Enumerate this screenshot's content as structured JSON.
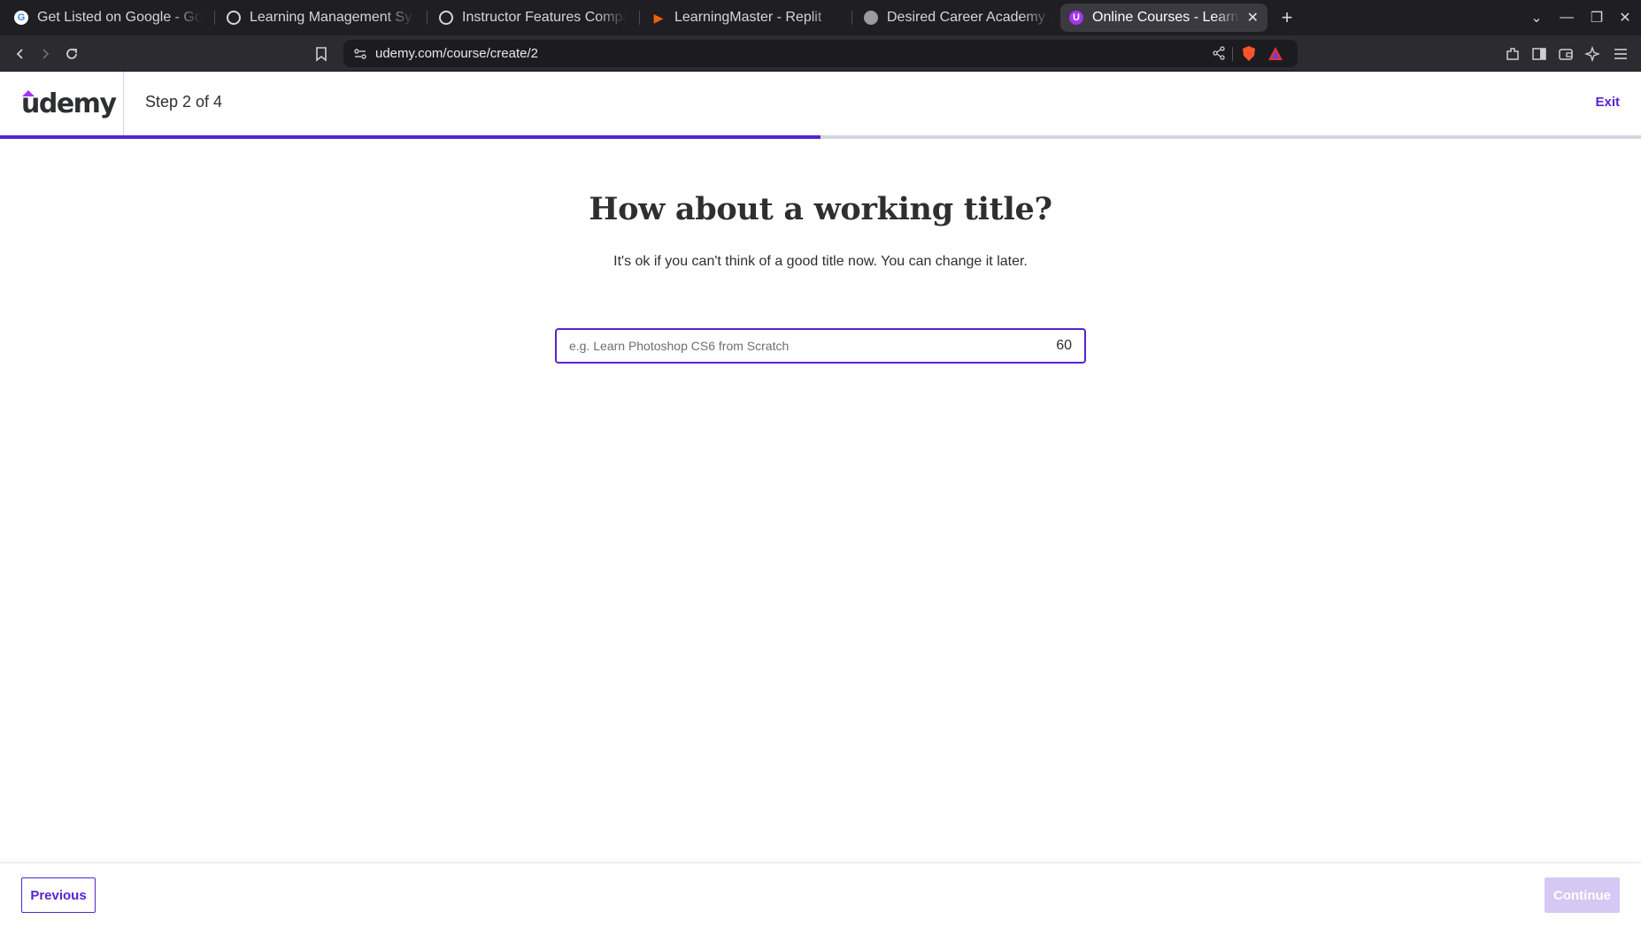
{
  "browser": {
    "tabs": [
      {
        "label": "Get Listed on Google - Goog",
        "icon": "google-icon",
        "active": false
      },
      {
        "label": "Learning Management Syste",
        "icon": "openai-icon",
        "active": false
      },
      {
        "label": "Instructor Features Compar",
        "icon": "openai-icon",
        "active": false
      },
      {
        "label": "LearningMaster - Replit",
        "icon": "replit-icon",
        "active": false
      },
      {
        "label": "Desired Career Academy | Er",
        "icon": "globe-icon",
        "active": false
      },
      {
        "label": "Online Courses - Learn A",
        "icon": "udemy-icon",
        "active": true
      }
    ],
    "url": "udemy.com/course/create/2"
  },
  "header": {
    "logo": "udemy",
    "step": "Step 2 of 4",
    "exit": "Exit"
  },
  "progress": {
    "current_step": 2,
    "total_steps": 4,
    "fraction": 0.5
  },
  "main": {
    "heading": "How about a working title?",
    "subtext": "It's ok if you can't think of a good title now. You can change it later.",
    "title_input": {
      "value": "",
      "placeholder": "e.g. Learn Photoshop CS6 from Scratch",
      "remaining_chars": "60"
    }
  },
  "footer": {
    "previous": "Previous",
    "continue": "Continue"
  },
  "colors": {
    "accent": "#5624d0",
    "disabled_button": "#d5c8f3",
    "text": "#2d2f31"
  }
}
